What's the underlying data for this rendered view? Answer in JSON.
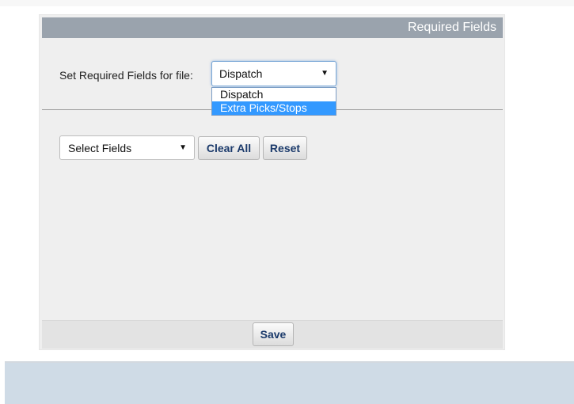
{
  "panel": {
    "title": "Required Fields"
  },
  "file_selector": {
    "label": "Set Required Fields for file:",
    "selected": "Dispatch",
    "options": [
      "Dispatch",
      "Extra Picks/Stops"
    ],
    "highlighted_option": "Extra Picks/Stops"
  },
  "fields_selector": {
    "selected": "Select Fields"
  },
  "buttons": {
    "clear_all": "Clear All",
    "reset": "Reset",
    "save": "Save"
  },
  "colors": {
    "header_bg": "#9aa3ad",
    "panel_bg": "#efefef",
    "highlight": "#3399ff",
    "footer_band": "#cfdbe6",
    "button_text": "#1b3a6b"
  }
}
